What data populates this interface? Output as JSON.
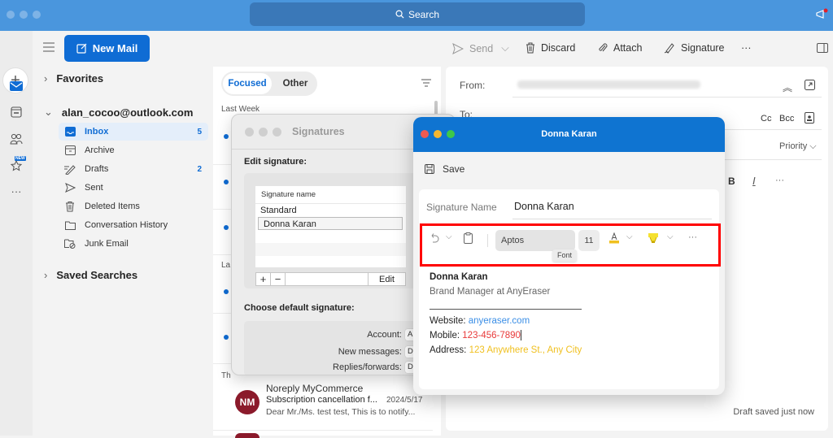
{
  "titlebar": {
    "search_label": "Search",
    "icons": [
      "search-icon",
      "announcement-icon"
    ]
  },
  "rail": {
    "items": [
      "compose-icon",
      "mail-icon",
      "calendar-icon",
      "people-icon",
      "favorites-star-icon",
      "more-icon"
    ],
    "new_badge": "NEW"
  },
  "toolbar": {
    "new_mail_label": "New Mail",
    "send_label": "Send",
    "discard_label": "Discard",
    "attach_label": "Attach",
    "signature_label": "Signature",
    "more_label": "···"
  },
  "folders": {
    "favorites_label": "Favorites",
    "account_label": "alan_cocoo@outlook.com",
    "items": [
      {
        "label": "Inbox",
        "icon": "inbox-icon",
        "count": "5",
        "active": true
      },
      {
        "label": "Archive",
        "icon": "archive-icon",
        "count": ""
      },
      {
        "label": "Drafts",
        "icon": "drafts-icon",
        "count": "2"
      },
      {
        "label": "Sent",
        "icon": "sent-icon",
        "count": ""
      },
      {
        "label": "Deleted Items",
        "icon": "trash-icon",
        "count": ""
      },
      {
        "label": "Conversation History",
        "icon": "folder-icon",
        "count": ""
      },
      {
        "label": "Junk Email",
        "icon": "junk-icon",
        "count": ""
      }
    ],
    "saved_searches_label": "Saved Searches"
  },
  "message_list": {
    "tab_focused": "Focused",
    "tab_other": "Other",
    "section_last_week": "Last Week",
    "section_la": "La",
    "section_th": "Th",
    "message": {
      "avatar": "NM",
      "sender": "Noreply MyCommerce",
      "subject": "Subscription cancellation f...",
      "date": "2024/5/17",
      "preview": "Dear Mr./Ms. test test, This is to notify..."
    }
  },
  "compose": {
    "from_label": "From:",
    "to_label": "To:",
    "cc_label": "Cc",
    "bcc_label": "Bcc",
    "priority_label": "Priority",
    "bold_label": "B",
    "italic_label": "I",
    "more_label": "···",
    "draft_status": "Draft saved just now"
  },
  "signatures_window": {
    "title": "Signatures",
    "edit_heading": "Edit signature:",
    "column_header": "Signature name",
    "signatures": [
      "Standard",
      "Donna Karan"
    ],
    "selected": "Donna Karan",
    "add_label": "+",
    "remove_label": "−",
    "edit_label": "Edit",
    "default_heading": "Choose default signature:",
    "account_label": "Account:",
    "account_value": "Alan Cocoo",
    "new_messages_label": "New messages:",
    "new_messages_value": "Donna Karan",
    "replies_label": "Replies/forwards:",
    "replies_value": "Donna Karan"
  },
  "editor_window": {
    "title": "Donna Karan",
    "save_label": "Save",
    "sig_name_label": "Signature Name",
    "sig_name_value": "Donna Karan",
    "font_value": "Aptos",
    "font_size": "11",
    "font_tooltip": "Font",
    "more_label": "···",
    "colors": {
      "highlight_box": "#ff0000",
      "title_bar": "#0f74d1",
      "link_blue": "#3a8ee6",
      "mobile_red": "#e83a3a",
      "address_yellow": "#f0c020"
    },
    "signature": {
      "name": "Donna Karan",
      "role": "Brand Manager at AnyEraser",
      "website_label": "Website:",
      "website_value": "anyeraser.com",
      "mobile_label": "Mobile:",
      "mobile_value": "123-456-7890",
      "address_label": "Address:",
      "address_value": "123 Anywhere St., Any City"
    }
  }
}
